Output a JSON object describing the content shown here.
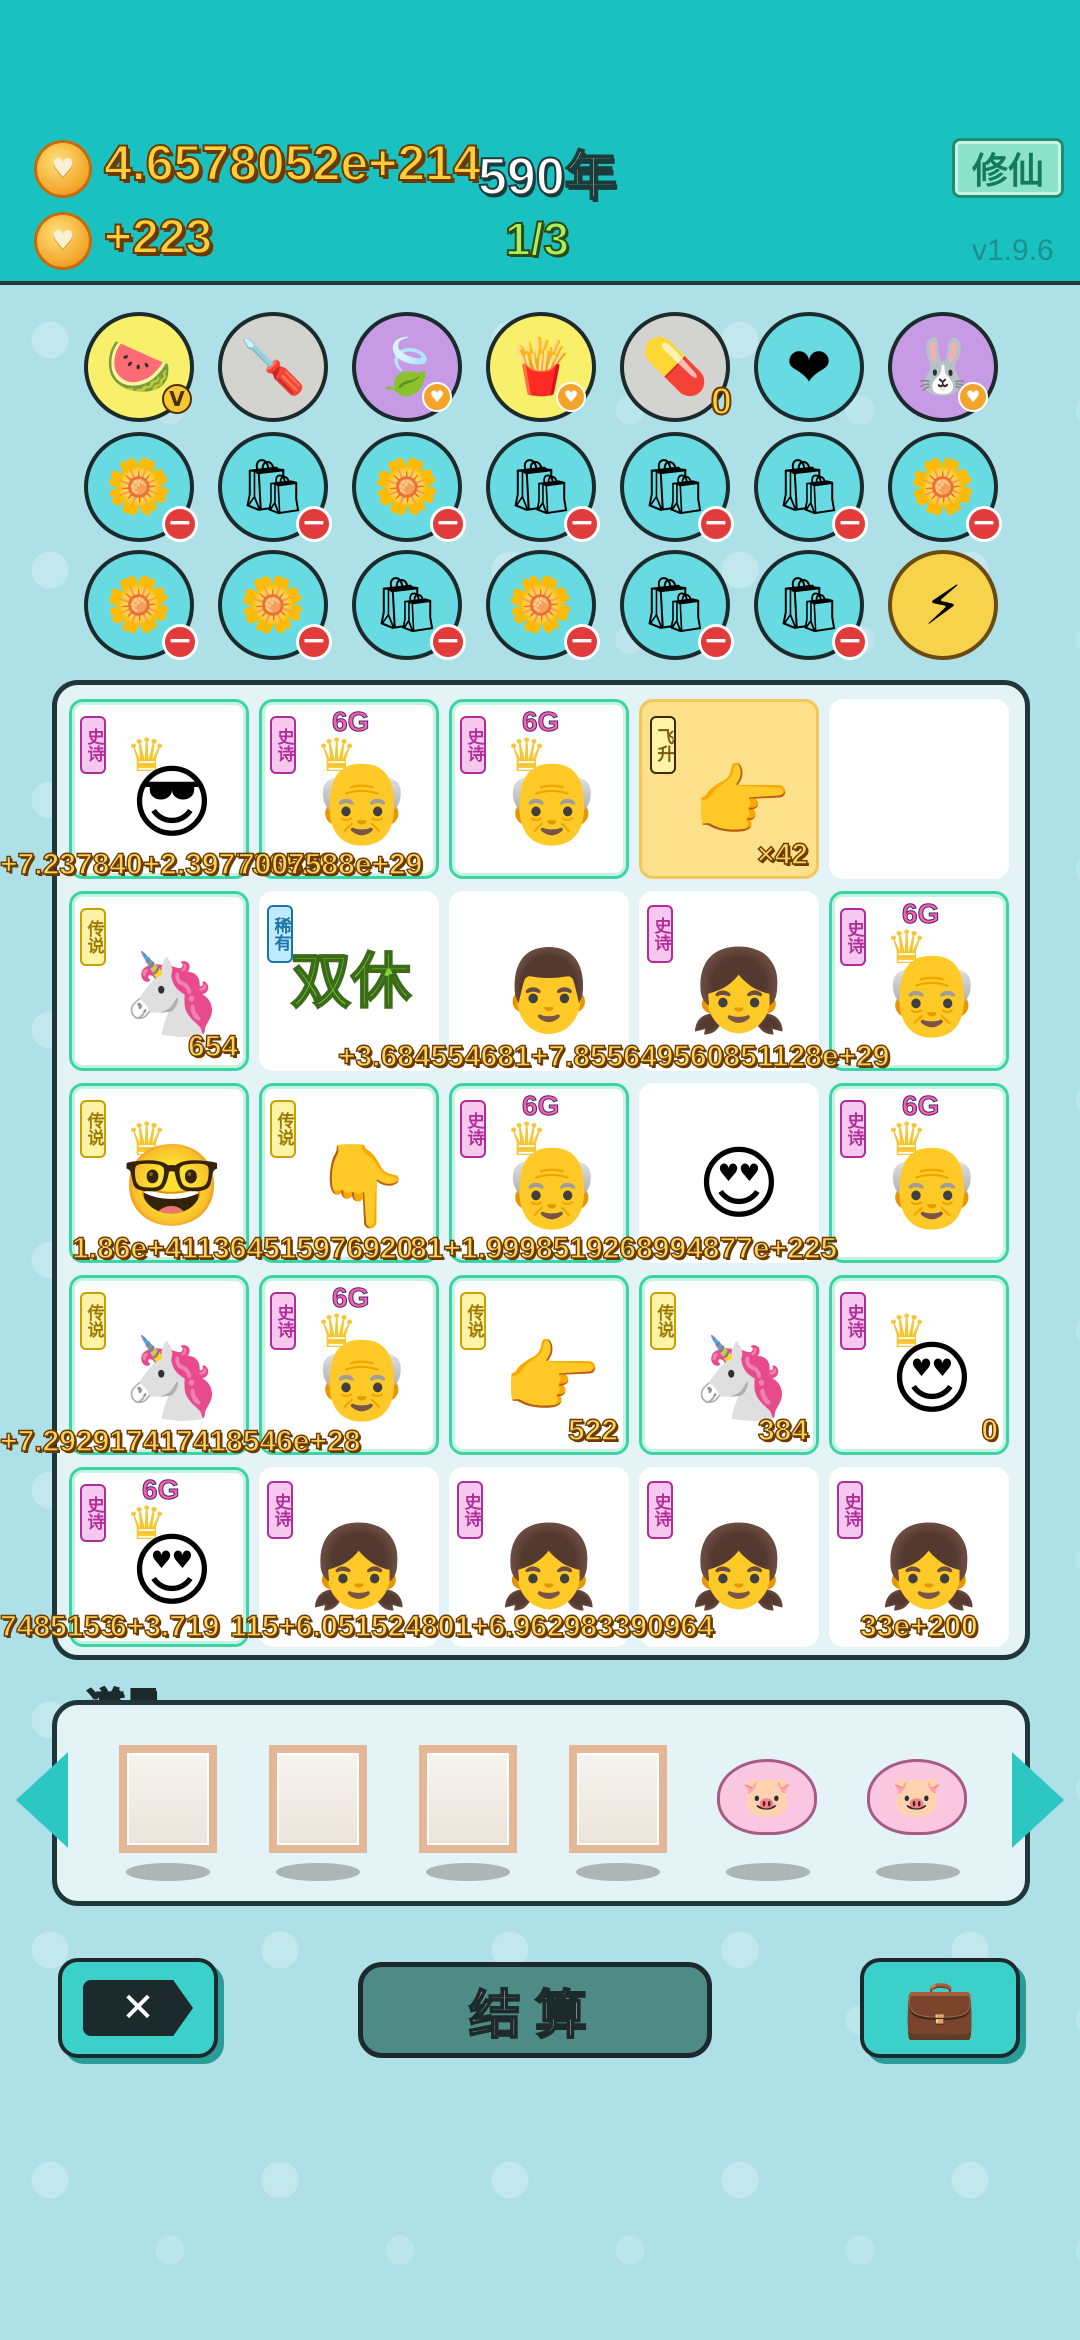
{
  "header": {
    "gold_value": "4.6578052e+214",
    "year_label": "590年",
    "income": "+223",
    "wave": "1/3",
    "xiuxian_label": "修仙",
    "version": "v1.9.6"
  },
  "icons": {
    "row1": [
      {
        "name": "fruit-basket-icon",
        "glyph": "🍉",
        "color": "yellow",
        "badge": "V"
      },
      {
        "name": "screwdriver-icon",
        "glyph": "🪛",
        "color": "gray"
      },
      {
        "name": "leaf-icon",
        "glyph": "🍃",
        "color": "purple",
        "badge": "coin"
      },
      {
        "name": "fries-icon",
        "glyph": "🍟",
        "color": "yellow",
        "badge": "coin"
      },
      {
        "name": "pill-tray-icon",
        "glyph": "💊",
        "color": "gray",
        "count": "0"
      },
      {
        "name": "blood-bag-icon",
        "glyph": "❤",
        "color": "teal"
      },
      {
        "name": "rabbit-icon",
        "glyph": "🐰",
        "color": "purple",
        "badge": "coin"
      }
    ],
    "row2": [
      {
        "name": "flower-pot-icon",
        "glyph": "🌼"
      },
      {
        "name": "sack-icon",
        "glyph": "🛍"
      },
      {
        "name": "flower-pot-icon",
        "glyph": "🌼"
      },
      {
        "name": "sack-icon",
        "glyph": "🛍"
      },
      {
        "name": "sack-icon",
        "glyph": "🛍"
      },
      {
        "name": "sack-icon",
        "glyph": "🛍"
      },
      {
        "name": "flower-pot-icon",
        "glyph": "🌼"
      }
    ],
    "row3": [
      {
        "name": "flower-pot-icon",
        "glyph": "🌼"
      },
      {
        "name": "flower-pot-icon",
        "glyph": "🌼"
      },
      {
        "name": "sack-icon",
        "glyph": "🛍"
      },
      {
        "name": "flower-pot-icon",
        "glyph": "🌼"
      },
      {
        "name": "sack-icon",
        "glyph": "🛍"
      },
      {
        "name": "sack-icon",
        "glyph": "🛍"
      },
      {
        "name": "lightning-icon",
        "glyph": "⚡"
      }
    ],
    "minus": "−"
  },
  "board": {
    "cells": [
      {
        "name": "old-man-sunglasses",
        "tag": "史诗",
        "tag_type": "epic",
        "glyph": "😎",
        "style": "green",
        "crown": true
      },
      {
        "name": "old-man-6g",
        "tag": "史诗",
        "tag_type": "epic",
        "glyph": "👴",
        "style": "green",
        "g6": "6G",
        "crown": true
      },
      {
        "name": "old-man-6g",
        "tag": "史诗",
        "tag_type": "epic",
        "glyph": "👴",
        "style": "green",
        "g6": "6G",
        "crown": true
      },
      {
        "name": "pointing-hand-gold",
        "tag": "飞升",
        "tag_type": "fly",
        "glyph": "👉",
        "style": "orange",
        "count": "×42"
      },
      {
        "name": "empty-slot",
        "style": "plain"
      },
      {
        "name": "unicorn",
        "tag": "传说",
        "tag_type": "legend",
        "glyph": "🦄",
        "style": "green",
        "count": "654"
      },
      {
        "name": "shuangxiu-card",
        "tag": "稀有",
        "tag_type": "rare",
        "text": "双休",
        "style": "plain"
      },
      {
        "name": "bald-man",
        "glyph": "👨",
        "style": "plain"
      },
      {
        "name": "braided-girl",
        "tag": "史诗",
        "tag_type": "epic",
        "glyph": "👧",
        "style": "plain"
      },
      {
        "name": "old-man-6g",
        "tag": "史诗",
        "tag_type": "epic",
        "glyph": "👴",
        "style": "green",
        "g6": "6G",
        "crown": true
      },
      {
        "name": "old-man-gold-glasses",
        "tag": "传说",
        "tag_type": "legend",
        "glyph": "🤓",
        "style": "green",
        "crown": true
      },
      {
        "name": "pointing-hand",
        "tag": "传说",
        "tag_type": "legend",
        "glyph": "👇",
        "style": "green"
      },
      {
        "name": "old-man-6g",
        "tag": "史诗",
        "tag_type": "epic",
        "glyph": "👴",
        "style": "green",
        "g6": "6G",
        "crown": true
      },
      {
        "name": "heart-eyes-man",
        "glyph": "😍",
        "style": "plain"
      },
      {
        "name": "old-man-6g",
        "tag": "史诗",
        "tag_type": "epic",
        "glyph": "👴",
        "style": "green",
        "g6": "6G",
        "crown": true
      },
      {
        "name": "unicorn",
        "tag": "传说",
        "tag_type": "legend",
        "glyph": "🦄",
        "style": "green"
      },
      {
        "name": "old-man-6g",
        "tag": "史诗",
        "tag_type": "epic",
        "glyph": "👴",
        "style": "green",
        "g6": "6G",
        "crown": true
      },
      {
        "name": "pointing-hand",
        "tag": "传说",
        "tag_type": "legend",
        "glyph": "👉",
        "style": "green",
        "count": "522"
      },
      {
        "name": "unicorn",
        "tag": "传说",
        "tag_type": "legend",
        "glyph": "🦄",
        "style": "green",
        "count": "384"
      },
      {
        "name": "heart-eyes-king",
        "tag": "史诗",
        "tag_type": "epic",
        "glyph": "😍",
        "style": "green",
        "crown": true,
        "count": "0"
      },
      {
        "name": "heart-eyes-6g",
        "tag": "史诗",
        "tag_type": "epic",
        "glyph": "😍",
        "style": "green",
        "g6": "6G",
        "crown": true
      },
      {
        "name": "braided-girl",
        "tag": "史诗",
        "tag_type": "epic",
        "glyph": "👧",
        "style": "plain"
      },
      {
        "name": "braided-girl",
        "tag": "史诗",
        "tag_type": "epic",
        "glyph": "👧",
        "style": "plain"
      },
      {
        "name": "braided-girl",
        "tag": "史诗",
        "tag_type": "epic",
        "glyph": "👧",
        "style": "plain"
      },
      {
        "name": "braided-girl",
        "tag": "史诗",
        "tag_type": "epic",
        "glyph": "👧",
        "style": "plain"
      }
    ],
    "overflow_numbers": [
      "+7.237840+2.397736520",
      "7007588e+29",
      "+3.684554681+7.855649560851128e+29",
      "1.86e+411364515976920",
      "81+1.9998519268994877e+225",
      "+7.292917417418546e+28",
      "7485153",
      "6+3.719",
      "115+6.051524801+6.962983390964",
      "33e+200"
    ]
  },
  "props": {
    "label": "道具",
    "slots": [
      "frame",
      "frame",
      "frame",
      "frame",
      "piggy-bank",
      "piggy-bank"
    ]
  },
  "buttons": {
    "close": "✕",
    "settle": "结算",
    "bag": "💼"
  }
}
